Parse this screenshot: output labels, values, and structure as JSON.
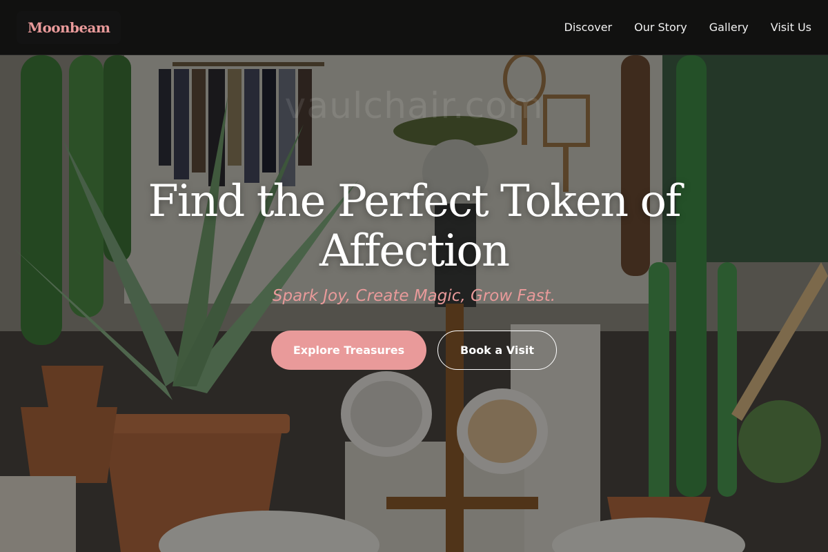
{
  "brand": {
    "name": "Moonbeam",
    "color": "#e99a9a"
  },
  "nav": {
    "links": [
      {
        "label": "Discover"
      },
      {
        "label": "Our Story"
      },
      {
        "label": "Gallery"
      },
      {
        "label": "Visit Us"
      }
    ]
  },
  "hero": {
    "title": "Find the Perfect Token of Affection",
    "tagline": "Spark Joy, Create Magic, Grow Fast.",
    "watermark": "vaulchair.com",
    "primary_button": "Explore Treasures",
    "secondary_button": "Book a Visit",
    "accent_color": "#e99a9a",
    "background": "gift shop interior with potted cacti, aloe plants, clothing rack, lantern, mugs on wooden stand"
  }
}
